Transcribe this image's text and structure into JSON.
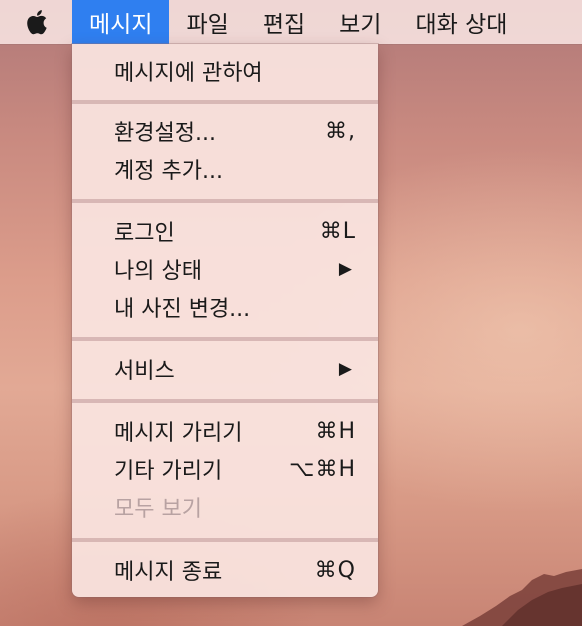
{
  "menubar": {
    "apple_icon": "apple-logo",
    "items": [
      {
        "label": "메시지",
        "active": true
      },
      {
        "label": "파일",
        "active": false
      },
      {
        "label": "편집",
        "active": false
      },
      {
        "label": "보기",
        "active": false
      },
      {
        "label": "대화 상대",
        "active": false
      }
    ]
  },
  "menu": {
    "about": {
      "label": "메시지에 관하여"
    },
    "preferences": {
      "label": "환경설정...",
      "shortcut": "⌘,"
    },
    "add_account": {
      "label": "계정 추가..."
    },
    "login": {
      "label": "로그인",
      "shortcut": "⌘L"
    },
    "my_status": {
      "label": "나의 상태",
      "submenu": "▶"
    },
    "change_photo": {
      "label": "내 사진 변경..."
    },
    "services": {
      "label": "서비스",
      "submenu": "▶"
    },
    "hide_messages": {
      "label": "메시지 가리기",
      "shortcut": "⌘H"
    },
    "hide_others": {
      "label": "기타 가리기",
      "shortcut": "⌥⌘H"
    },
    "show_all": {
      "label": "모두 보기",
      "disabled": true
    },
    "quit": {
      "label": "메시지 종료",
      "shortcut": "⌘Q"
    }
  },
  "colors": {
    "accent": "#2f7ff0",
    "disabled_text": "#b8a2a2"
  }
}
